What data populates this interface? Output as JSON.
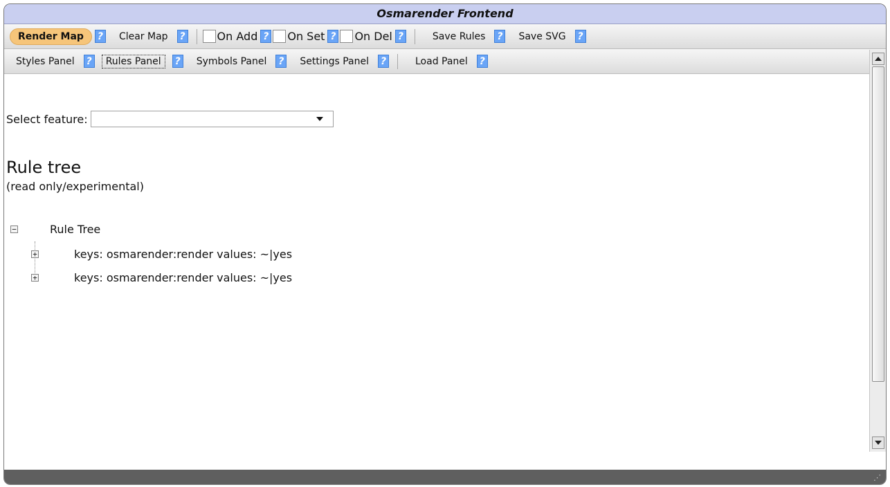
{
  "window": {
    "title": "Osmarender Frontend"
  },
  "toolbar1": {
    "render_map": "Render Map",
    "help": "?",
    "clear_map": "Clear Map",
    "on_add": "On Add",
    "on_set": "On Set",
    "on_del": "On Del",
    "save_rules": "Save Rules",
    "save_svg": "Save SVG"
  },
  "toolbar2": {
    "styles_panel": "Styles Panel",
    "rules_panel": "Rules Panel",
    "symbols_panel": "Symbols Panel",
    "settings_panel": "Settings Panel",
    "load_panel": "Load Panel"
  },
  "content": {
    "select_label": "Select feature:",
    "select_value": "",
    "heading": "Rule tree",
    "subheading": "(read only/experimental)",
    "tree": {
      "root": {
        "label": "Rule Tree",
        "toggle": "−"
      },
      "children": [
        {
          "label": "keys: osmarender:render values: ~|yes",
          "toggle": "+"
        },
        {
          "label": "keys: osmarender:render values: ~|yes",
          "toggle": "+"
        }
      ]
    }
  },
  "colors": {
    "titlebar": "#c9cff0",
    "primary_button": "#f6c57a",
    "help_icon": "#6aa5f7",
    "statusbar": "#5f5f5f"
  }
}
